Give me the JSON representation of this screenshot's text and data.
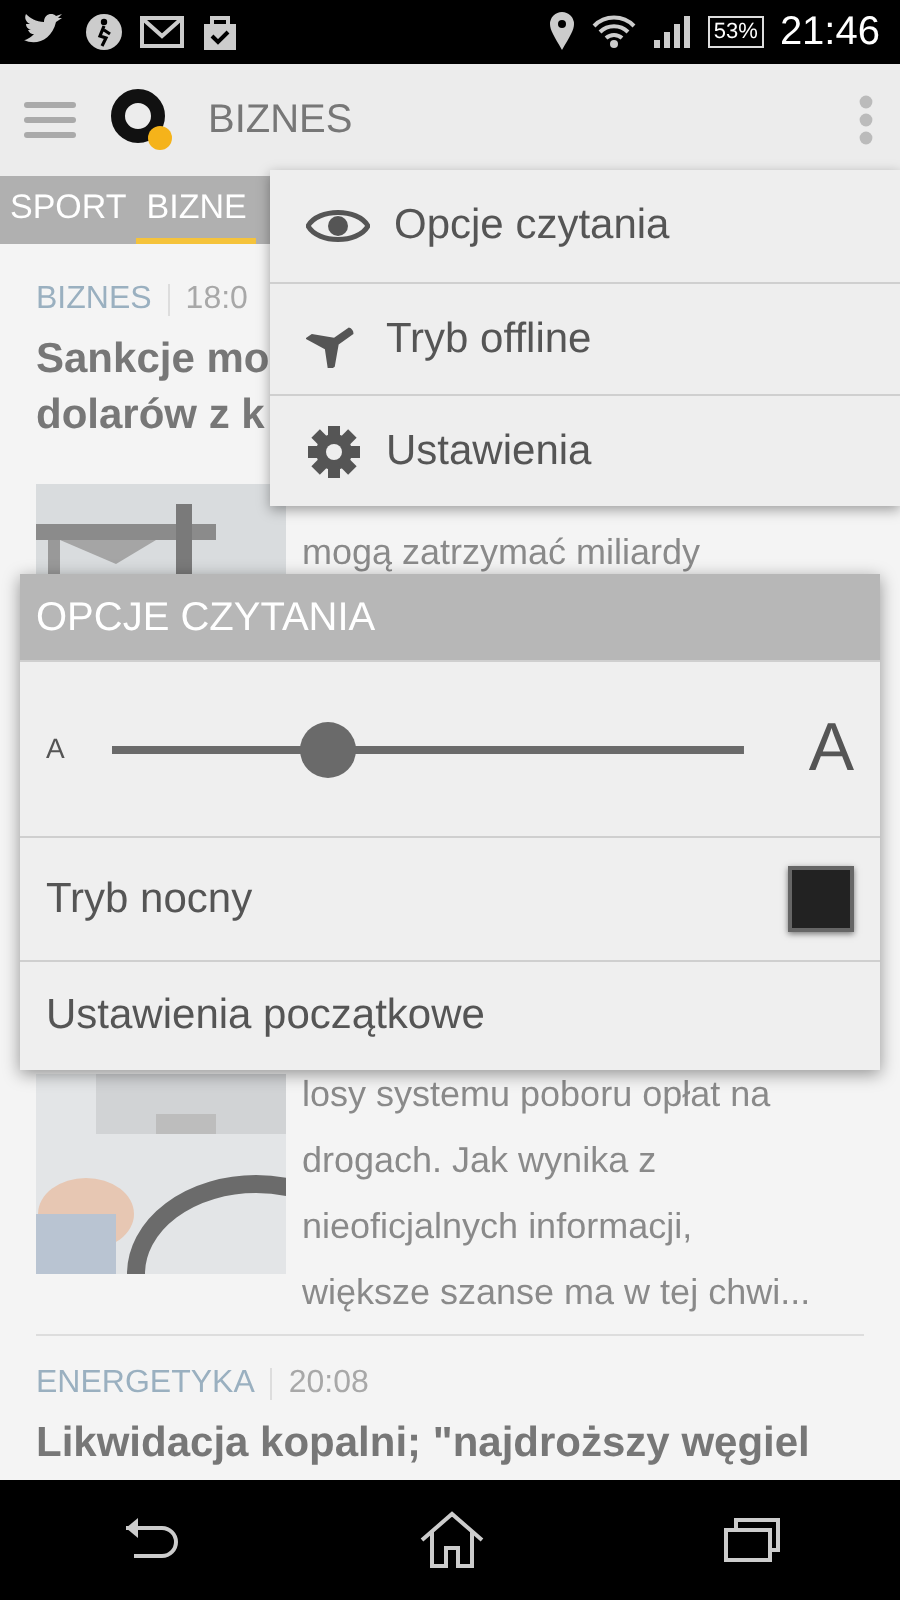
{
  "status_bar": {
    "battery": "53%",
    "time": "21:46"
  },
  "app_bar": {
    "title": "BIZNES"
  },
  "tabs": [
    {
      "label": "SPORT",
      "selected": false
    },
    {
      "label": "BIZNE",
      "selected": true
    }
  ],
  "articles": [
    {
      "category": "BIZNES",
      "time": "18:0",
      "headline_lines": [
        "Sankcje mo",
        "dolarów z k"
      ],
      "excerpt_lines": [
        "mogą zatrzymać miliardy"
      ]
    },
    {
      "excerpt_lines": [
        "losy systemu poboru opłat na",
        "drogach. Jak wynika z",
        "nieoficjalnych informacji,",
        "większe szanse ma w tej chwi..."
      ]
    },
    {
      "category": "ENERGETYKA",
      "time": "20:08",
      "headline_lines": [
        "Likwidacja kopalni; \"najdroższy węgiel"
      ]
    }
  ],
  "menu": {
    "items": [
      {
        "kind": "eye",
        "label": "Opcje czytania"
      },
      {
        "kind": "plane",
        "label": "Tryb offline"
      },
      {
        "kind": "gear",
        "label": "Ustawienia"
      }
    ]
  },
  "dialog": {
    "title": "OPCJE CZYTANIA",
    "font_size": {
      "small_label": "A",
      "large_label": "A",
      "level": 0.34
    },
    "night_mode": {
      "label": "Tryb nocny",
      "checked": false
    },
    "reset": {
      "label": "Ustawienia początkowe"
    }
  }
}
